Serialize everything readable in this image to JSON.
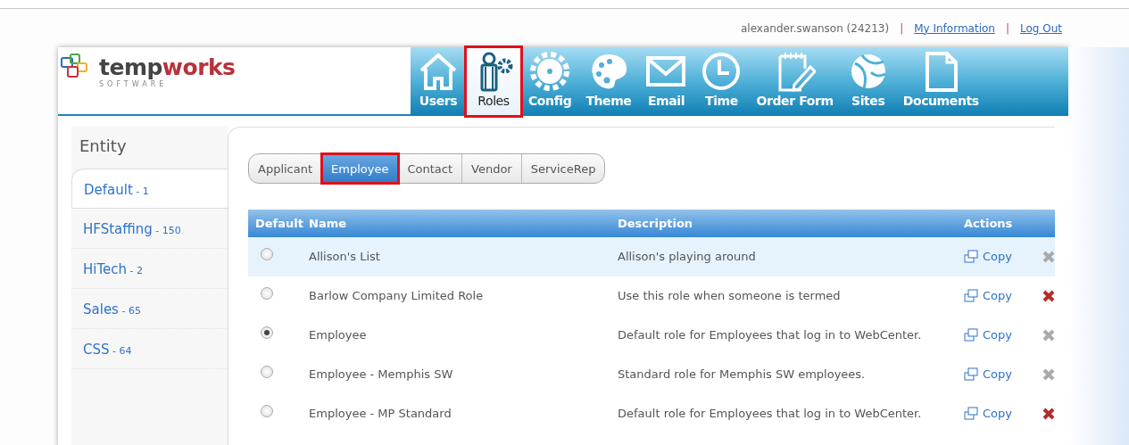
{
  "user_bar": {
    "user": "alexander.swanson (24213)",
    "links": [
      {
        "separator": "|",
        "label": "My Information"
      },
      {
        "separator": "|",
        "label": "Log Out"
      }
    ]
  },
  "logo": {
    "word_dark": "temp",
    "word_red": "works",
    "tagline": "SOFTWARE"
  },
  "nav": [
    {
      "label": "Users",
      "kind": "house",
      "selected": false,
      "highlighted": false
    },
    {
      "label": "Roles",
      "kind": "roles",
      "selected": true,
      "highlighted": true
    },
    {
      "label": "Config",
      "kind": "gear",
      "selected": false,
      "highlighted": false
    },
    {
      "label": "Theme",
      "kind": "palette",
      "selected": false,
      "highlighted": false
    },
    {
      "label": "Email",
      "kind": "envelope",
      "selected": false,
      "highlighted": false
    },
    {
      "label": "Time",
      "kind": "clock",
      "selected": false,
      "highlighted": false
    },
    {
      "label": "Order Form",
      "kind": "notepad",
      "selected": false,
      "highlighted": false
    },
    {
      "label": "Sites",
      "kind": "globe",
      "selected": false,
      "highlighted": false
    },
    {
      "label": "Documents",
      "kind": "document",
      "selected": false,
      "highlighted": false
    }
  ],
  "sidebar": {
    "title": "Entity",
    "items": [
      {
        "name": "Default",
        "count": "- 1",
        "selected": true
      },
      {
        "name": "HFStaffing",
        "count": "- 150",
        "selected": false
      },
      {
        "name": "HiTech",
        "count": "- 2",
        "selected": false
      },
      {
        "name": "Sales",
        "count": "- 65",
        "selected": false
      },
      {
        "name": "CSS",
        "count": "- 64",
        "selected": false
      }
    ]
  },
  "tabs": [
    {
      "label": "Applicant",
      "selected": false,
      "highlighted": false
    },
    {
      "label": "Employee",
      "selected": true,
      "highlighted": true
    },
    {
      "label": "Contact",
      "selected": false,
      "highlighted": false
    },
    {
      "label": "Vendor",
      "selected": false,
      "highlighted": false
    },
    {
      "label": "ServiceRep",
      "selected": false,
      "highlighted": false
    }
  ],
  "table": {
    "columns": [
      "Default",
      "Name",
      "Description",
      "Actions"
    ],
    "rows": [
      {
        "checked": false,
        "name": "Allison's List",
        "description": "Allison's playing around",
        "copy": "Copy",
        "delete_enabled": false,
        "selected": true
      },
      {
        "checked": false,
        "name": "Barlow Company Limited Role",
        "description": "Use this role when someone is termed",
        "copy": "Copy",
        "delete_enabled": true,
        "selected": false
      },
      {
        "checked": true,
        "name": "Employee",
        "description": "Default role for Employees that log in to WebCenter.",
        "copy": "Copy",
        "delete_enabled": false,
        "selected": false
      },
      {
        "checked": false,
        "name": "Employee - Memphis SW",
        "description": "Standard role for Memphis SW employees.",
        "copy": "Copy",
        "delete_enabled": false,
        "selected": false
      },
      {
        "checked": false,
        "name": "Employee - MP Standard",
        "description": "Default role for Employees that log in to WebCenter.",
        "copy": "Copy",
        "delete_enabled": true,
        "selected": false
      }
    ]
  }
}
